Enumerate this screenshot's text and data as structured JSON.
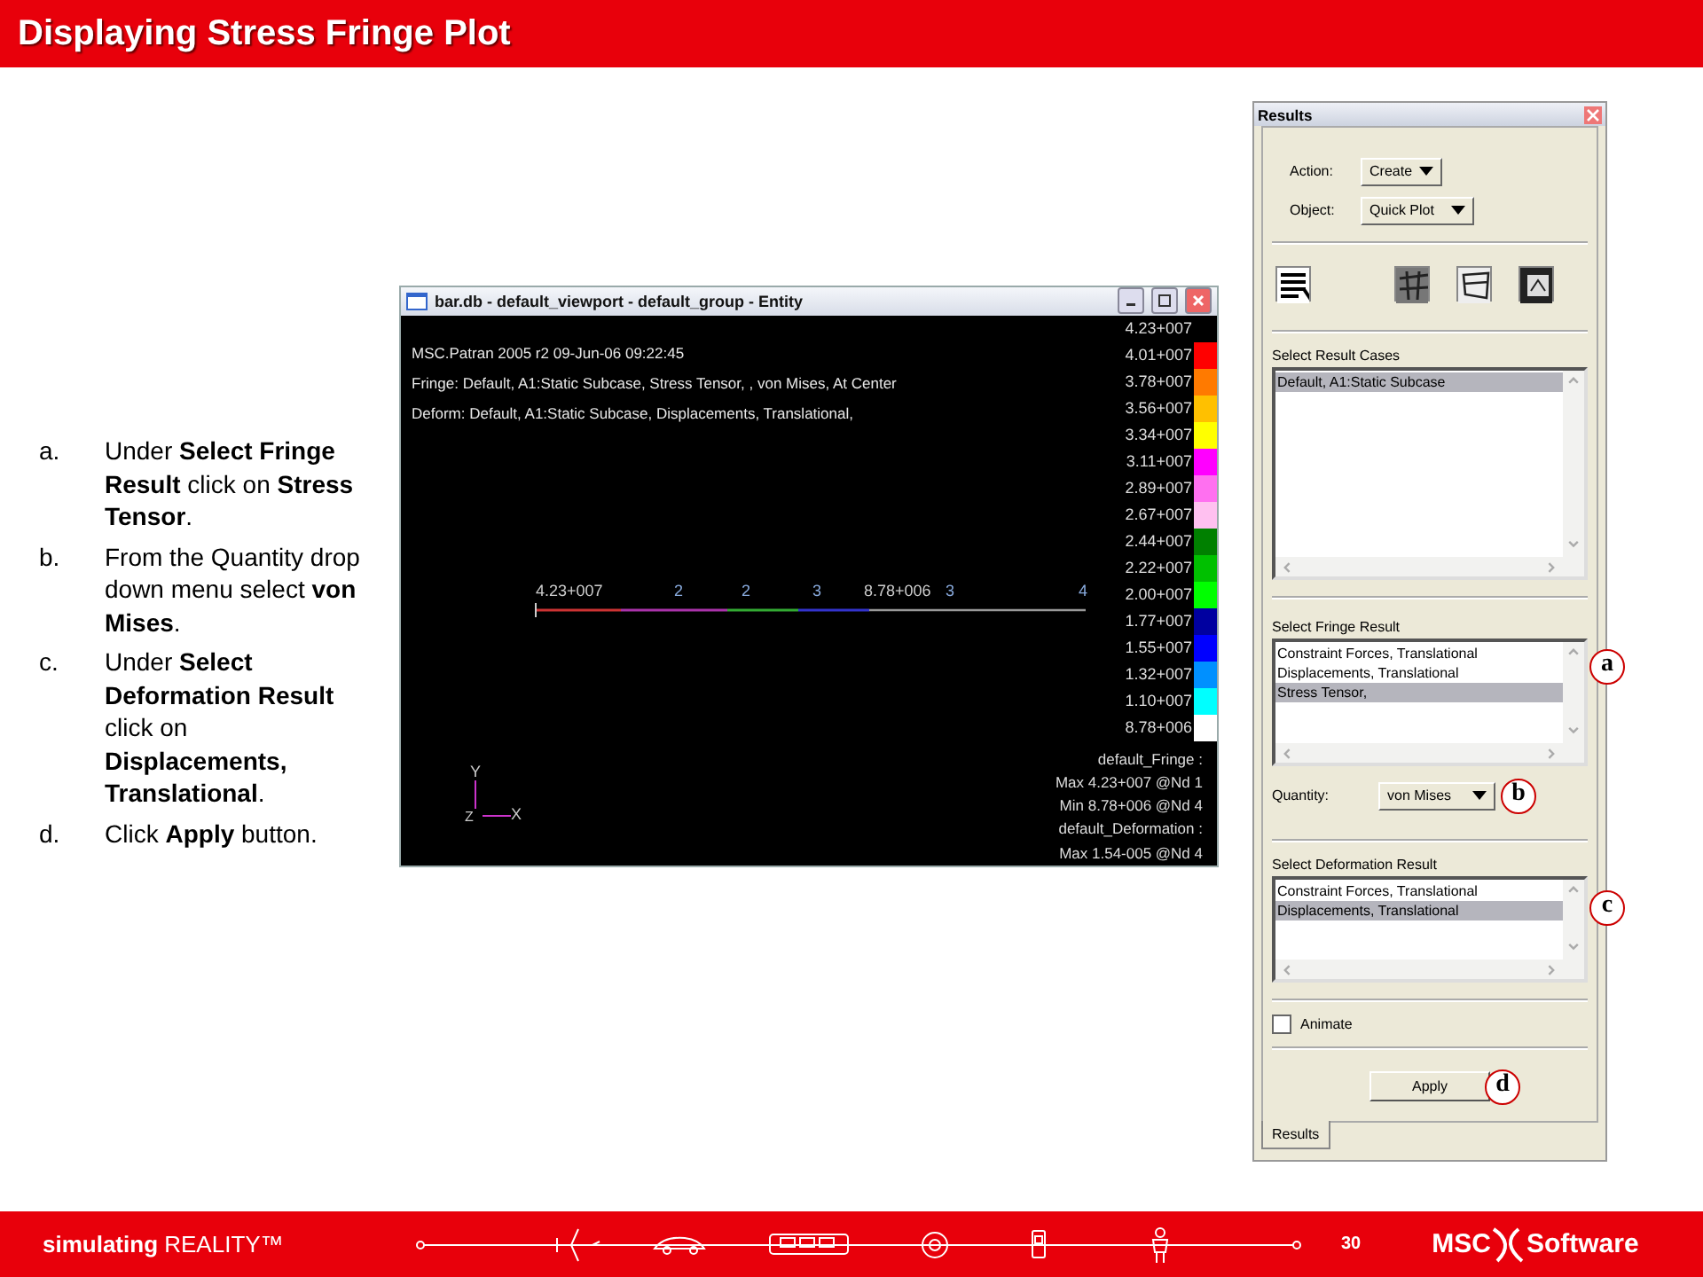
{
  "slide_title": "Displaying Stress Fringe Plot",
  "steps": [
    {
      "marker": "a.",
      "text": "Under **Select Fringe Result** click on **Stress Tensor**."
    },
    {
      "marker": "b.",
      "text": "From the Quantity drop down menu select **von Mises**."
    },
    {
      "marker": "c.",
      "text": "Under **Select Deformation Result** click on **Displacements, Translational**."
    },
    {
      "marker": "d.",
      "text": "Click **Apply** button."
    }
  ],
  "viewport_window": {
    "title": "bar.db - default_viewport - default_group - Entity",
    "info_lines": [
      "MSC.Patran 2005 r2 09-Jun-06 09:22:45",
      "Fringe: Default, A1:Static Subcase, Stress Tensor, , von Mises, At Center",
      "Deform: Default, A1:Static Subcase, Displacements, Translational,"
    ],
    "node_labels": [
      "4.23+007",
      "2",
      "2",
      "3",
      "8.78+006",
      "3",
      "4"
    ],
    "axes": [
      "Y",
      "Z",
      "X"
    ],
    "legend": [
      {
        "label": "4.23+007",
        "color": "#000000"
      },
      {
        "label": "4.01+007",
        "color": "#ff0000"
      },
      {
        "label": "3.78+007",
        "color": "#ff7a00"
      },
      {
        "label": "3.56+007",
        "color": "#ffc000"
      },
      {
        "label": "3.34+007",
        "color": "#ffff00"
      },
      {
        "label": "3.11+007",
        "color": "#ff00ff"
      },
      {
        "label": "2.89+007",
        "color": "#ff70f0"
      },
      {
        "label": "2.67+007",
        "color": "#ffc0f0"
      },
      {
        "label": "2.44+007",
        "color": "#008000"
      },
      {
        "label": "2.22+007",
        "color": "#00c000"
      },
      {
        "label": "2.00+007",
        "color": "#00ff00"
      },
      {
        "label": "1.77+007",
        "color": "#0000a0"
      },
      {
        "label": "1.55+007",
        "color": "#0000ff"
      },
      {
        "label": "1.32+007",
        "color": "#0090ff"
      },
      {
        "label": "1.10+007",
        "color": "#00ffff"
      },
      {
        "label": "8.78+006",
        "color": "#ffffff"
      }
    ],
    "summary": [
      "default_Fringe :",
      "Max 4.23+007 @Nd 1",
      "Min 8.78+006 @Nd 4",
      "default_Deformation :",
      "Max 1.54-005 @Nd 4"
    ]
  },
  "results_panel": {
    "title": "Results",
    "action": {
      "label": "Action:",
      "value": "Create"
    },
    "object": {
      "label": "Object:",
      "value": "Quick Plot"
    },
    "result_cases": {
      "label": "Select Result Cases",
      "items": [
        {
          "text": "Default, A1:Static Subcase",
          "selected": true
        }
      ]
    },
    "fringe_result": {
      "label": "Select Fringe Result",
      "callout": "a",
      "items": [
        {
          "text": "Constraint Forces, Translational",
          "selected": false
        },
        {
          "text": "Displacements, Translational",
          "selected": false
        },
        {
          "text": "Stress Tensor,",
          "selected": true
        }
      ]
    },
    "quantity": {
      "label": "Quantity:",
      "value": "von Mises",
      "callout": "b"
    },
    "deformation_result": {
      "label": "Select Deformation Result",
      "callout": "c",
      "items": [
        {
          "text": "Constraint Forces, Translational",
          "selected": false
        },
        {
          "text": "Displacements, Translational",
          "selected": true
        }
      ]
    },
    "animate": {
      "label": "Animate",
      "checked": false
    },
    "apply": {
      "label": "Apply",
      "callout": "d"
    },
    "tab": {
      "label": "Results",
      "selected": true
    }
  },
  "footer": {
    "tagline": "**simulating** REALITY™",
    "page": "30",
    "logo_left": "MSC",
    "logo_right": "Software"
  }
}
